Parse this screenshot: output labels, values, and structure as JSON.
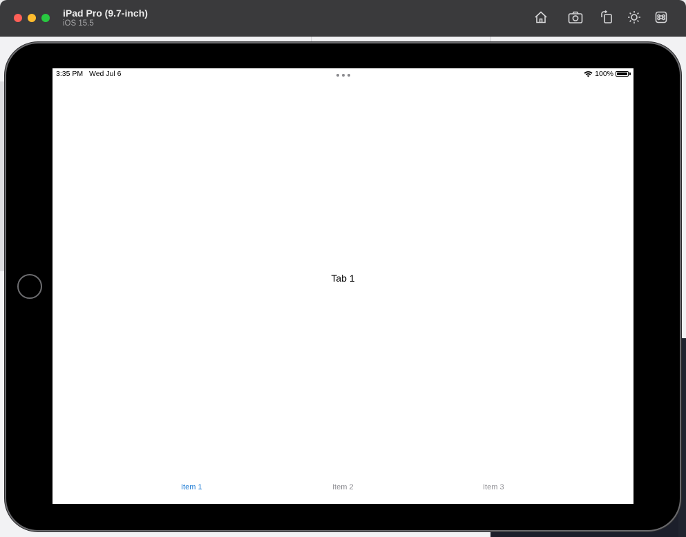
{
  "window": {
    "device_name": "iPad Pro (9.7-inch)",
    "os_version": "iOS 15.5"
  },
  "toolbar": {
    "icons": [
      "home-icon",
      "screenshot-icon",
      "rotate-icon",
      "appearance-icon",
      "command-icon"
    ]
  },
  "status_bar": {
    "time": "3:35 PM",
    "date": "Wed Jul 6",
    "battery_percent": "100%",
    "battery_level": 1.0
  },
  "content": {
    "label": "Tab 1"
  },
  "tab_bar": {
    "items": [
      {
        "label": "Item 1",
        "active": true
      },
      {
        "label": "Item 2",
        "active": false
      },
      {
        "label": "Item 3",
        "active": false
      }
    ]
  },
  "colors": {
    "accent": "#1a7ad4",
    "inactive_tab": "#8e8e93",
    "titlebar": "#3a3a3c"
  }
}
